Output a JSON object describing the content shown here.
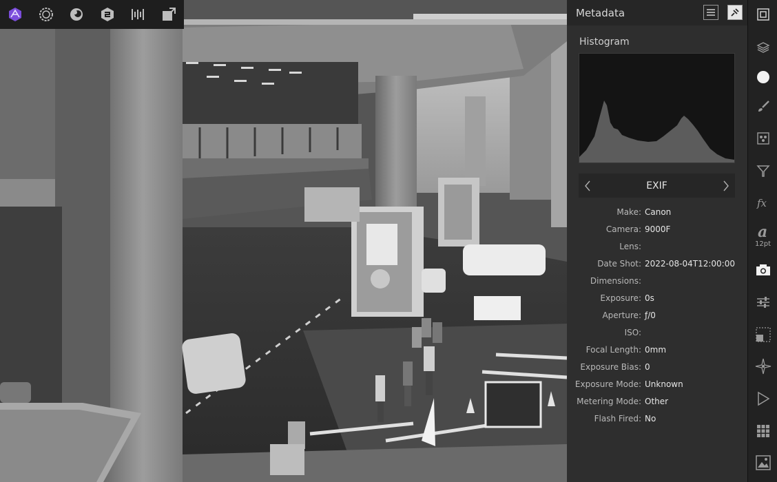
{
  "personas": [
    {
      "name": "photo-persona-icon",
      "accent": "#7b4ddb"
    },
    {
      "name": "liquify-persona-icon"
    },
    {
      "name": "develop-persona-icon"
    },
    {
      "name": "tone-mapping-persona-icon"
    },
    {
      "name": "export-persona-icon"
    },
    {
      "name": "share-icon"
    }
  ],
  "panel": {
    "title": "Metadata",
    "histogram_label": "Histogram",
    "exif_title": "EXIF",
    "rows": [
      {
        "label": "Make:",
        "value": "Canon"
      },
      {
        "label": "Camera:",
        "value": "9000F"
      },
      {
        "label": "Lens:",
        "value": ""
      },
      {
        "label": "Date Shot:",
        "value": "2022-08-04T12:00:00"
      },
      {
        "label": "Dimensions:",
        "value": ""
      },
      {
        "label": "Exposure:",
        "value": "0s"
      },
      {
        "label": "Aperture:",
        "value": "ƒ/0"
      },
      {
        "label": "ISO:",
        "value": ""
      },
      {
        "label": "Focal Length:",
        "value": "0mm"
      },
      {
        "label": "Exposure Bias:",
        "value": "0"
      },
      {
        "label": "Exposure Mode:",
        "value": "Unknown"
      },
      {
        "label": "Metering Mode:",
        "value": "Other"
      },
      {
        "label": "Flash Fired:",
        "value": "No"
      }
    ]
  },
  "studio": {
    "font_size_label": "12pt",
    "tools": [
      "navigator-icon",
      "layers-icon",
      "color-icon",
      "brush-icon",
      "channels-icon",
      "filter-icon",
      "fx-icon",
      "character-icon",
      "metadata-camera-icon",
      "adjustments-icon",
      "transform-icon",
      "navigator-compass-icon",
      "play-icon",
      "grid-icon",
      "image-icon"
    ]
  },
  "colors": {
    "accent": "#7b4ddb",
    "panel_bg": "#2e2e2e",
    "histogram_fill": "#5c5c5c"
  }
}
